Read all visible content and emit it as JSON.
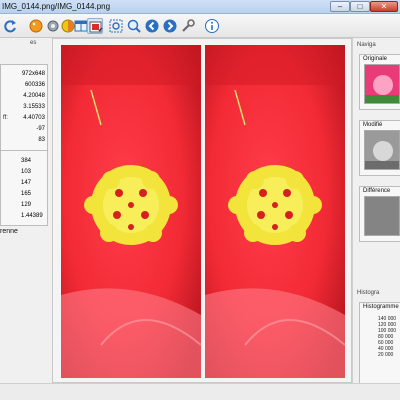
{
  "window": {
    "title": "IMG_0144.png/IMG_0144.png",
    "min": "–",
    "max": "□",
    "close": "✕"
  },
  "toolbar": {
    "icons": [
      "refresh-icon",
      "palette-icon",
      "settings-icon",
      "color-picker-icon",
      "layout-icon",
      "photo-edit-icon",
      "zoom-fit-icon",
      "zoom-in-icon",
      "back-icon",
      "forward-icon",
      "tools-icon",
      "info-icon"
    ]
  },
  "left_panel": {
    "header": "es",
    "stats": [
      {
        "key": "",
        "value": "972x648"
      },
      {
        "key": "",
        "value": "600336"
      },
      {
        "key": "",
        "value": "4.20048"
      },
      {
        "key": "",
        "value": "3.15533"
      },
      {
        "key": "ff:",
        "value": "4.40703"
      },
      {
        "key": "",
        "value": "-97"
      },
      {
        "key": "",
        "value": "83"
      }
    ],
    "stats2": [
      {
        "key": "",
        "value": "384"
      },
      {
        "key": "",
        "value": "103"
      },
      {
        "key": "",
        "value": "147"
      },
      {
        "key": "",
        "value": "165"
      },
      {
        "key": "",
        "value": "129"
      },
      {
        "key": "",
        "value": "1.44389"
      }
    ],
    "footer": "renne"
  },
  "navigation": {
    "header": "Naviga",
    "originale": "Originale",
    "modifie": "Modifié",
    "difference": "Différence"
  },
  "histogram": {
    "header": "Histogra",
    "title": "Histogramme",
    "y_ticks": [
      "140 000",
      "120 000",
      "100 000",
      "80 000",
      "60 000",
      "40 000",
      "20 000"
    ]
  }
}
